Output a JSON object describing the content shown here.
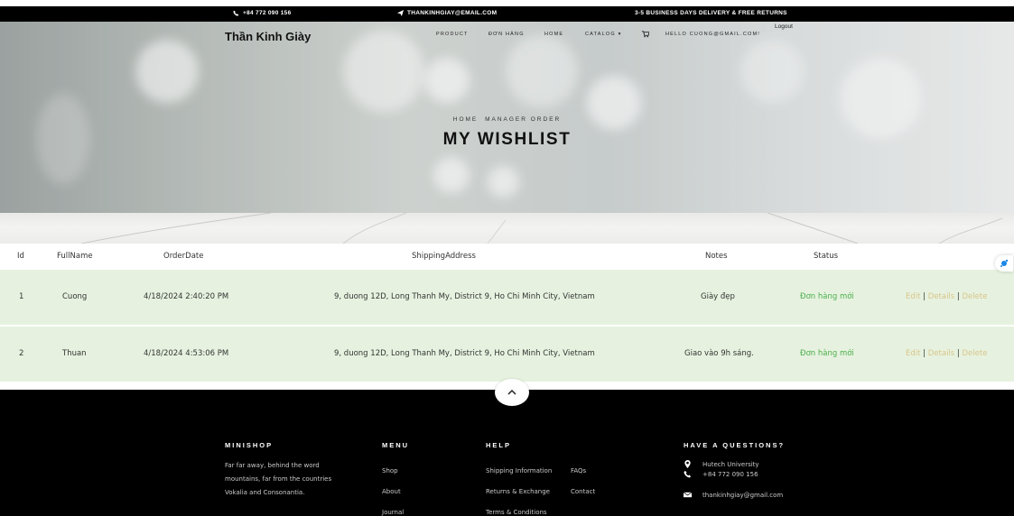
{
  "topbar": {
    "phone": "+84 772 090 156",
    "email": "THANKINHGIAY@EMAIL.COM",
    "delivery": "3-5 BUSINESS DAYS DELIVERY & FREE RETURNS"
  },
  "header": {
    "brand": "Thần Kinh Giày",
    "nav": [
      "PRODUCT",
      "ĐƠN HÀNG",
      "HOME",
      "CATALOG"
    ],
    "user_email": "HELLO CUONG@GMAIL.COM!",
    "logout": "Logout"
  },
  "hero": {
    "breadcrumb": [
      "HOME",
      "MANAGER ORDER"
    ],
    "title": "MY WISHLIST"
  },
  "table": {
    "columns": [
      "Id",
      "FullName",
      "OrderDate",
      "ShippingAddress",
      "Notes",
      "Status"
    ],
    "rows": [
      {
        "id": "1",
        "name": "Cuong",
        "date": "4/18/2024 2:40:20 PM",
        "address": "9, duong 12D, Long Thanh My, District 9, Ho Chi Minh City, Vietnam",
        "notes": "Giày đẹp",
        "status": "Đơn hàng mới"
      },
      {
        "id": "2",
        "name": "Thuan",
        "date": "4/18/2024 4:53:06 PM",
        "address": "9, duong 12D, Long Thanh My, District 9, Ho Chi Minh City, Vietnam",
        "notes": "Giao vào 9h sáng.",
        "status": "Đơn hàng mới"
      }
    ],
    "actions": {
      "edit": "Edit",
      "details": "Details",
      "delete": "Delete",
      "sep": "|"
    }
  },
  "footer": {
    "about_title": "MINISHOP",
    "about_lines": [
      "Far far away, behind the word",
      "mountains, far from the countries",
      "Vokalia and Consonantia."
    ],
    "menu_title": "MENU",
    "menu_items": [
      "Shop",
      "About",
      "Journal"
    ],
    "help_title": "HELP",
    "help_col1": [
      "Shipping Information",
      "Returns & Exchange",
      "Terms & Conditions"
    ],
    "help_col2": [
      "FAQs",
      "Contact"
    ],
    "contact_title": "HAVE A QUESTIONS?",
    "address": "Hutech University",
    "phone": "+84 772 090 156",
    "email": "thankinhgiay@gmail.com"
  },
  "colors": {
    "row_bg": "#e6f2df",
    "status": "#4cae4c",
    "action": "#d9c58a",
    "footer_bg": "#000000"
  }
}
